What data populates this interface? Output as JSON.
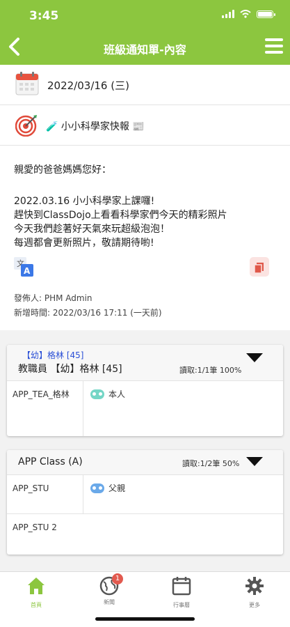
{
  "status_bar": {
    "time": "3:45"
  },
  "nav": {
    "title": "班級通知單-內容"
  },
  "notice": {
    "date": "2022/03/16 (三)",
    "title": "🧪 小小科學家快報 📰",
    "greeting": "親愛的爸爸媽媽您好：",
    "message_lines": [
      "2022.03.16 小小科學家上課囉!",
      "趕快到ClassDojo上看看科學家們今天的精彩照片",
      "今天我們趁著好天氣來玩超級泡泡！",
      "每週都會更新照片，敬請期待喲!"
    ],
    "publisher": "發佈人: PHM Admin",
    "added_time": "新增時間: 2022/03/16 17:11 (一天前)"
  },
  "cards": [
    {
      "tag": "【幼】格林 [45]",
      "header": "教職員 【幼】格林 [45]",
      "read": "讀取:1/1筆 100%",
      "rows": [
        {
          "account": "APP_TEA_格林",
          "reader": "本人"
        }
      ]
    },
    {
      "header": "APP Class (A)",
      "read": "讀取:1/2筆 50%",
      "rows": [
        {
          "account": "APP_STU",
          "reader": "父親"
        },
        {
          "account": "APP_STU 2",
          "reader": ""
        }
      ]
    }
  ],
  "tabs": [
    {
      "label": "首頁",
      "icon": "home-icon",
      "active": true
    },
    {
      "label": "新聞",
      "icon": "globe-icon",
      "badge": "1"
    },
    {
      "label": "行事曆",
      "icon": "calendar-icon"
    },
    {
      "label": "更多",
      "icon": "gear-icon"
    }
  ],
  "colors": {
    "primary": "#8cc63f",
    "tag_blue": "#2a4fd6",
    "badge_red": "#e25a4f"
  }
}
